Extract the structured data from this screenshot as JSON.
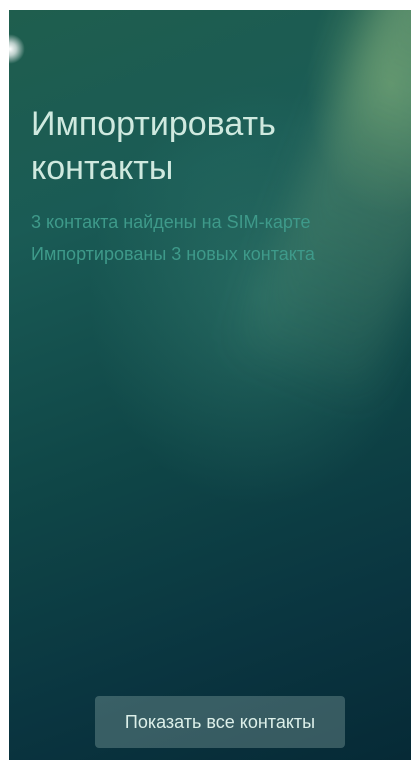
{
  "page": {
    "title": "Импортировать контакты"
  },
  "status": {
    "found_text": "3 контакта найдены на SIM-карте",
    "imported_text": "Импортированы 3 новых контакта"
  },
  "actions": {
    "show_all_label": "Показать все контакты"
  },
  "theme": {
    "title_color": "#cfe9df",
    "status_color": "#3e9a8a",
    "background_dark": "#062a36",
    "background_light": "#1f5e4e"
  }
}
